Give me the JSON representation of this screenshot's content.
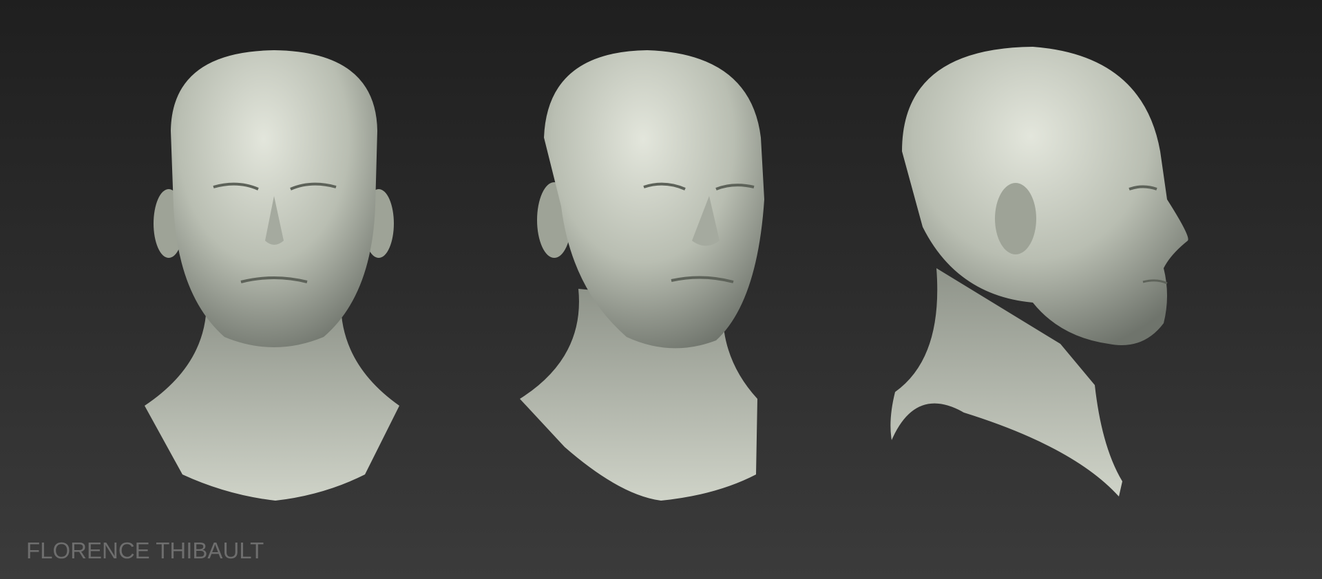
{
  "credit": "FLORENCE THIBAULT",
  "colors": {
    "background_top": "#1f1f1f",
    "background_bottom": "#3b3b3b",
    "sculpt": "#c9cdc2",
    "credit_text": "#6e6e6e"
  }
}
